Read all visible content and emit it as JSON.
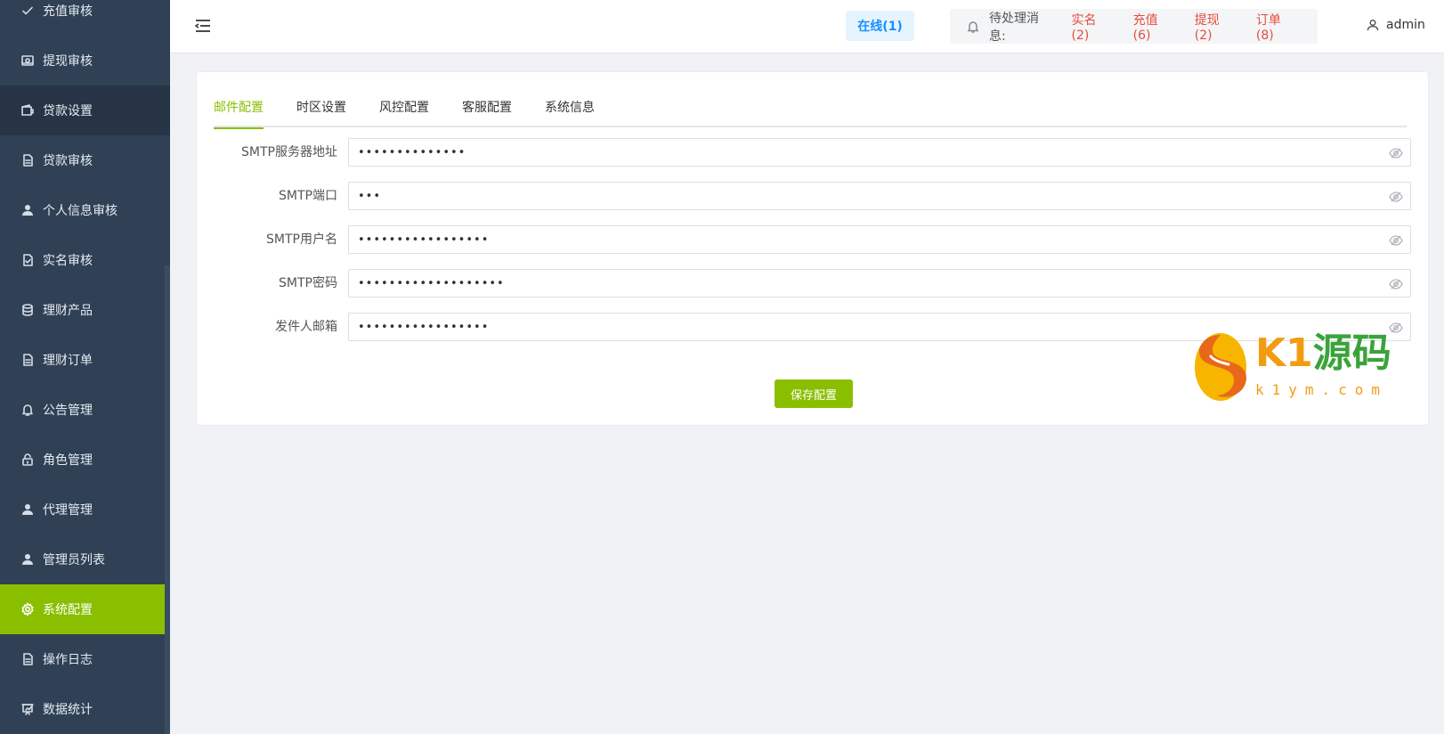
{
  "sidebar": {
    "items": [
      {
        "label": "充值审核",
        "icon": "check-icon"
      },
      {
        "label": "提现审核",
        "icon": "withdraw-icon"
      },
      {
        "label": "贷款设置",
        "icon": "wallet-icon"
      },
      {
        "label": "贷款审核",
        "icon": "document-icon"
      },
      {
        "label": "个人信息审核",
        "icon": "user-icon"
      },
      {
        "label": "实名审核",
        "icon": "document-check-icon"
      },
      {
        "label": "理财产品",
        "icon": "database-icon"
      },
      {
        "label": "理财订单",
        "icon": "document-icon"
      },
      {
        "label": "公告管理",
        "icon": "bell-icon"
      },
      {
        "label": "角色管理",
        "icon": "lock-icon"
      },
      {
        "label": "代理管理",
        "icon": "user-icon"
      },
      {
        "label": "管理员列表",
        "icon": "user-icon"
      },
      {
        "label": "系统配置",
        "icon": "gear-icon"
      },
      {
        "label": "操作日志",
        "icon": "document-icon"
      },
      {
        "label": "数据统计",
        "icon": "chart-board-icon"
      }
    ],
    "active_label": "系统配置",
    "active_color": "#8abf00",
    "background_color": "#304156"
  },
  "header": {
    "online": "在线(1)",
    "pending_label": "待处理消息:",
    "pending_links": [
      "实名(2)",
      "充值(6)",
      "提现(2)",
      "订单(8)"
    ],
    "username": "admin"
  },
  "tabs": [
    {
      "label": "邮件配置",
      "active": true
    },
    {
      "label": "时区设置",
      "active": false
    },
    {
      "label": "风控配置",
      "active": false
    },
    {
      "label": "客服配置",
      "active": false
    },
    {
      "label": "系统信息",
      "active": false
    }
  ],
  "form": {
    "fields": [
      {
        "label": "SMTP服务器地址",
        "value": "••••••••••••••"
      },
      {
        "label": "SMTP端口",
        "value": "•••"
      },
      {
        "label": "SMTP用户名",
        "value": "•••••••••••••••••"
      },
      {
        "label": "SMTP密码",
        "value": "•••••••••••••••••••"
      },
      {
        "label": "发件人邮箱",
        "value": "•••••••••••••••••"
      }
    ],
    "save_label": "保存配置"
  },
  "watermark": {
    "title_a": "K1",
    "title_b": "源码",
    "subtitle": "k1ym.com"
  }
}
